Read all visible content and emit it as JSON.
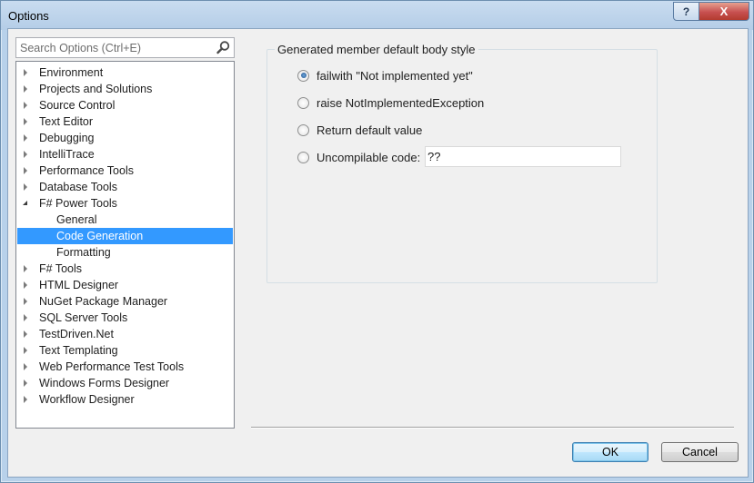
{
  "window": {
    "title": "Options",
    "help_label": "?",
    "close_label": "X"
  },
  "search": {
    "placeholder": "Search Options (Ctrl+E)",
    "value": ""
  },
  "tree": {
    "items": [
      {
        "label": "Environment",
        "level": 0,
        "expanded": false,
        "selected": false
      },
      {
        "label": "Projects and Solutions",
        "level": 0,
        "expanded": false,
        "selected": false
      },
      {
        "label": "Source Control",
        "level": 0,
        "expanded": false,
        "selected": false
      },
      {
        "label": "Text Editor",
        "level": 0,
        "expanded": false,
        "selected": false
      },
      {
        "label": "Debugging",
        "level": 0,
        "expanded": false,
        "selected": false
      },
      {
        "label": "IntelliTrace",
        "level": 0,
        "expanded": false,
        "selected": false
      },
      {
        "label": "Performance Tools",
        "level": 0,
        "expanded": false,
        "selected": false
      },
      {
        "label": "Database Tools",
        "level": 0,
        "expanded": false,
        "selected": false
      },
      {
        "label": "F# Power Tools",
        "level": 0,
        "expanded": true,
        "selected": false
      },
      {
        "label": "General",
        "level": 1,
        "expanded": false,
        "selected": false
      },
      {
        "label": "Code Generation",
        "level": 1,
        "expanded": false,
        "selected": true
      },
      {
        "label": "Formatting",
        "level": 1,
        "expanded": false,
        "selected": false
      },
      {
        "label": "F# Tools",
        "level": 0,
        "expanded": false,
        "selected": false
      },
      {
        "label": "HTML Designer",
        "level": 0,
        "expanded": false,
        "selected": false
      },
      {
        "label": "NuGet Package Manager",
        "level": 0,
        "expanded": false,
        "selected": false
      },
      {
        "label": "SQL Server Tools",
        "level": 0,
        "expanded": false,
        "selected": false
      },
      {
        "label": "TestDriven.Net",
        "level": 0,
        "expanded": false,
        "selected": false
      },
      {
        "label": "Text Templating",
        "level": 0,
        "expanded": false,
        "selected": false
      },
      {
        "label": "Web Performance Test Tools",
        "level": 0,
        "expanded": false,
        "selected": false
      },
      {
        "label": "Windows Forms Designer",
        "level": 0,
        "expanded": false,
        "selected": false
      },
      {
        "label": "Workflow Designer",
        "level": 0,
        "expanded": false,
        "selected": false
      }
    ]
  },
  "settings": {
    "group_title": "Generated member default body style",
    "options": [
      {
        "label": "failwith \"Not implemented yet\"",
        "checked": true
      },
      {
        "label": "raise NotImplementedException",
        "checked": false
      },
      {
        "label": "Return default value",
        "checked": false
      },
      {
        "label": "Uncompilable code:",
        "checked": false
      }
    ],
    "uncompilable_code_value": "??"
  },
  "buttons": {
    "ok_label": "OK",
    "cancel_label": "Cancel"
  },
  "colors": {
    "selection": "#3399ff",
    "title_bar": "#b9d1ea",
    "close_button": "#c75050"
  }
}
